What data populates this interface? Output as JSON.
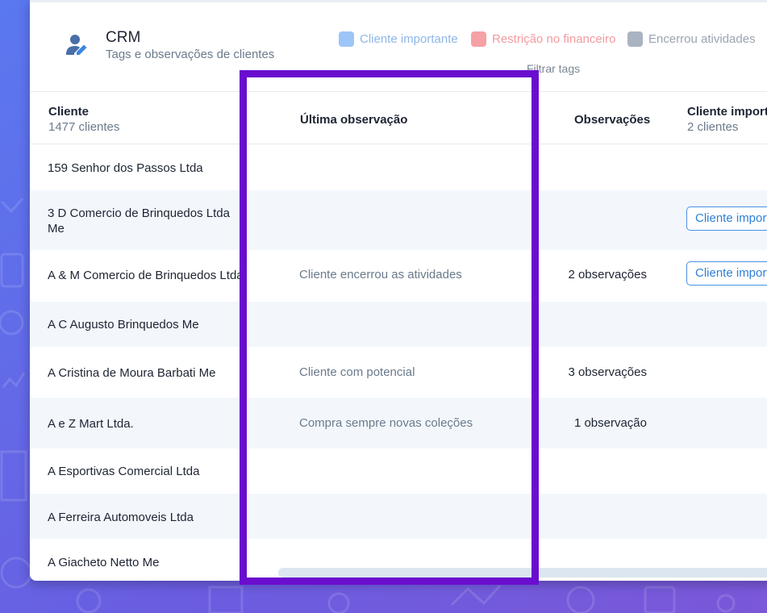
{
  "header": {
    "title": "CRM",
    "subtitle": "Tags e observações de clientes",
    "filter_label": "Filtrar tags",
    "legend": [
      {
        "label": "Cliente importante",
        "color": "#9ec5f8",
        "text_color": "#8fb6e8"
      },
      {
        "label": "Restrição no financeiro",
        "color": "#f6a1a6",
        "text_color": "#f19aa0"
      },
      {
        "label": "Encerrou atividades",
        "color": "#aab3c2",
        "text_color": "#9aa3b2"
      }
    ]
  },
  "table": {
    "col_cliente": "Cliente",
    "col_cliente_count": "1477 clientes",
    "col_ultima": "Última observação",
    "col_observacoes": "Observações",
    "col_importante": "Cliente importante",
    "col_importante_count": "2 clientes",
    "rows": [
      {
        "name": "159 Senhor dos Passos Ltda",
        "obs": "",
        "count": "",
        "tag": ""
      },
      {
        "name": "3 D Comercio de Brinquedos Ltda Me",
        "obs": "",
        "count": "",
        "tag": "Cliente importante"
      },
      {
        "name": "A & M Comercio de Brinquedos Ltda",
        "obs": "Cliente encerrou as atividades",
        "count": "2 observações",
        "tag": "Cliente importante"
      },
      {
        "name": "A C Augusto Brinquedos Me",
        "obs": "",
        "count": "",
        "tag": ""
      },
      {
        "name": "A Cristina de Moura Barbati Me",
        "obs": "Cliente com potencial",
        "count": "3 observações",
        "tag": ""
      },
      {
        "name": "A e Z  Mart Ltda.",
        "obs": "Compra sempre novas coleções",
        "count": "1 observação",
        "tag": ""
      },
      {
        "name": "A Esportivas Comercial Ltda",
        "obs": "",
        "count": "",
        "tag": ""
      },
      {
        "name": "A Ferreira Automoveis Ltda",
        "obs": "",
        "count": "",
        "tag": ""
      },
      {
        "name": "A Giacheto Netto Me",
        "obs": "",
        "count": "",
        "tag": ""
      }
    ]
  }
}
